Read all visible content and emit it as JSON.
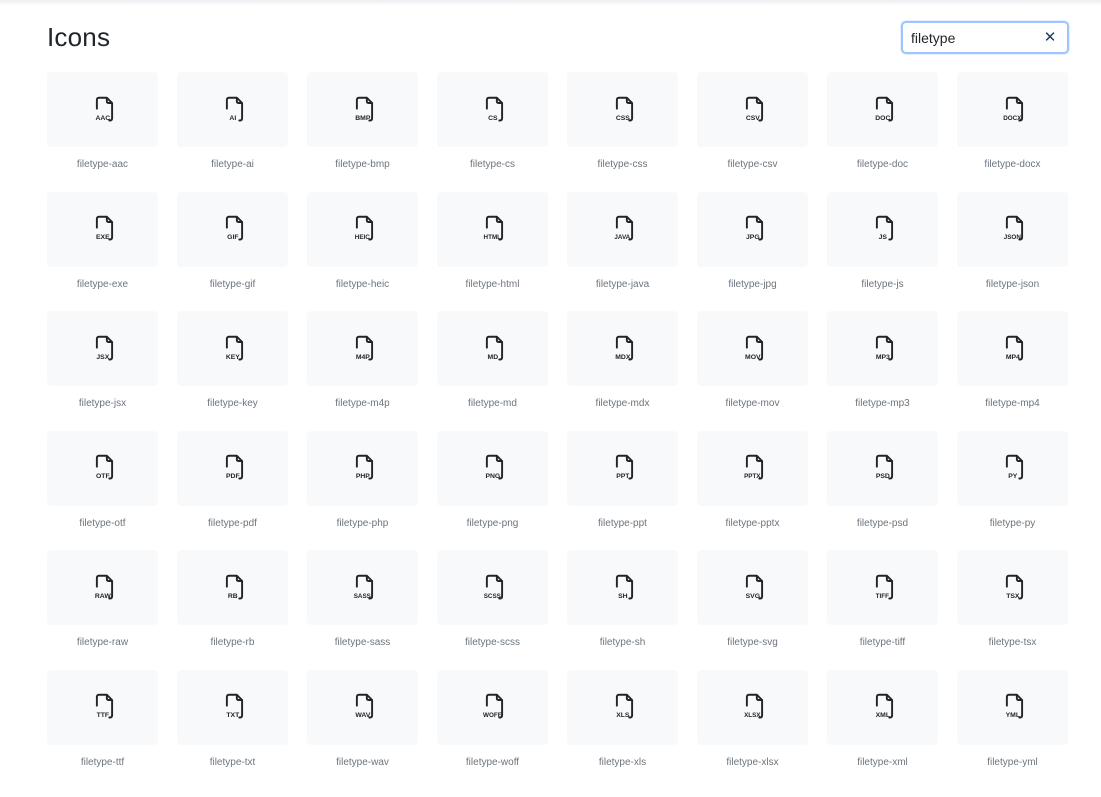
{
  "page": {
    "title": "Icons"
  },
  "search": {
    "value": "filetype",
    "clear_icon": "close-icon"
  },
  "icons": [
    {
      "name": "filetype-aac",
      "ext": "AAC"
    },
    {
      "name": "filetype-ai",
      "ext": "AI"
    },
    {
      "name": "filetype-bmp",
      "ext": "BMP"
    },
    {
      "name": "filetype-cs",
      "ext": "CS"
    },
    {
      "name": "filetype-css",
      "ext": "CSS"
    },
    {
      "name": "filetype-csv",
      "ext": "CSV"
    },
    {
      "name": "filetype-doc",
      "ext": "DOC"
    },
    {
      "name": "filetype-docx",
      "ext": "DOCX"
    },
    {
      "name": "filetype-exe",
      "ext": "EXE"
    },
    {
      "name": "filetype-gif",
      "ext": "GIF"
    },
    {
      "name": "filetype-heic",
      "ext": "HEIC"
    },
    {
      "name": "filetype-html",
      "ext": "HTML"
    },
    {
      "name": "filetype-java",
      "ext": "JAVA"
    },
    {
      "name": "filetype-jpg",
      "ext": "JPG"
    },
    {
      "name": "filetype-js",
      "ext": "JS"
    },
    {
      "name": "filetype-json",
      "ext": "JSON"
    },
    {
      "name": "filetype-jsx",
      "ext": "JSX"
    },
    {
      "name": "filetype-key",
      "ext": "KEY"
    },
    {
      "name": "filetype-m4p",
      "ext": "M4P"
    },
    {
      "name": "filetype-md",
      "ext": "MD"
    },
    {
      "name": "filetype-mdx",
      "ext": "MDX"
    },
    {
      "name": "filetype-mov",
      "ext": "MOV"
    },
    {
      "name": "filetype-mp3",
      "ext": "MP3"
    },
    {
      "name": "filetype-mp4",
      "ext": "MP4"
    },
    {
      "name": "filetype-otf",
      "ext": "OTF"
    },
    {
      "name": "filetype-pdf",
      "ext": "PDF"
    },
    {
      "name": "filetype-php",
      "ext": "PHP"
    },
    {
      "name": "filetype-png",
      "ext": "PNG"
    },
    {
      "name": "filetype-ppt",
      "ext": "PPT"
    },
    {
      "name": "filetype-pptx",
      "ext": "PPTX"
    },
    {
      "name": "filetype-psd",
      "ext": "PSD"
    },
    {
      "name": "filetype-py",
      "ext": "PY"
    },
    {
      "name": "filetype-raw",
      "ext": "RAW"
    },
    {
      "name": "filetype-rb",
      "ext": "RB"
    },
    {
      "name": "filetype-sass",
      "ext": "SASS"
    },
    {
      "name": "filetype-scss",
      "ext": "SCSS"
    },
    {
      "name": "filetype-sh",
      "ext": "SH"
    },
    {
      "name": "filetype-svg",
      "ext": "SVG"
    },
    {
      "name": "filetype-tiff",
      "ext": "TIFF"
    },
    {
      "name": "filetype-tsx",
      "ext": "TSX"
    },
    {
      "name": "filetype-ttf",
      "ext": "TTF"
    },
    {
      "name": "filetype-txt",
      "ext": "TXT"
    },
    {
      "name": "filetype-wav",
      "ext": "WAV"
    },
    {
      "name": "filetype-woff",
      "ext": "WOFF"
    },
    {
      "name": "filetype-xls",
      "ext": "XLS"
    },
    {
      "name": "filetype-xlsx",
      "ext": "XLSX"
    },
    {
      "name": "filetype-xml",
      "ext": "XML"
    },
    {
      "name": "filetype-yml",
      "ext": "YML"
    }
  ]
}
